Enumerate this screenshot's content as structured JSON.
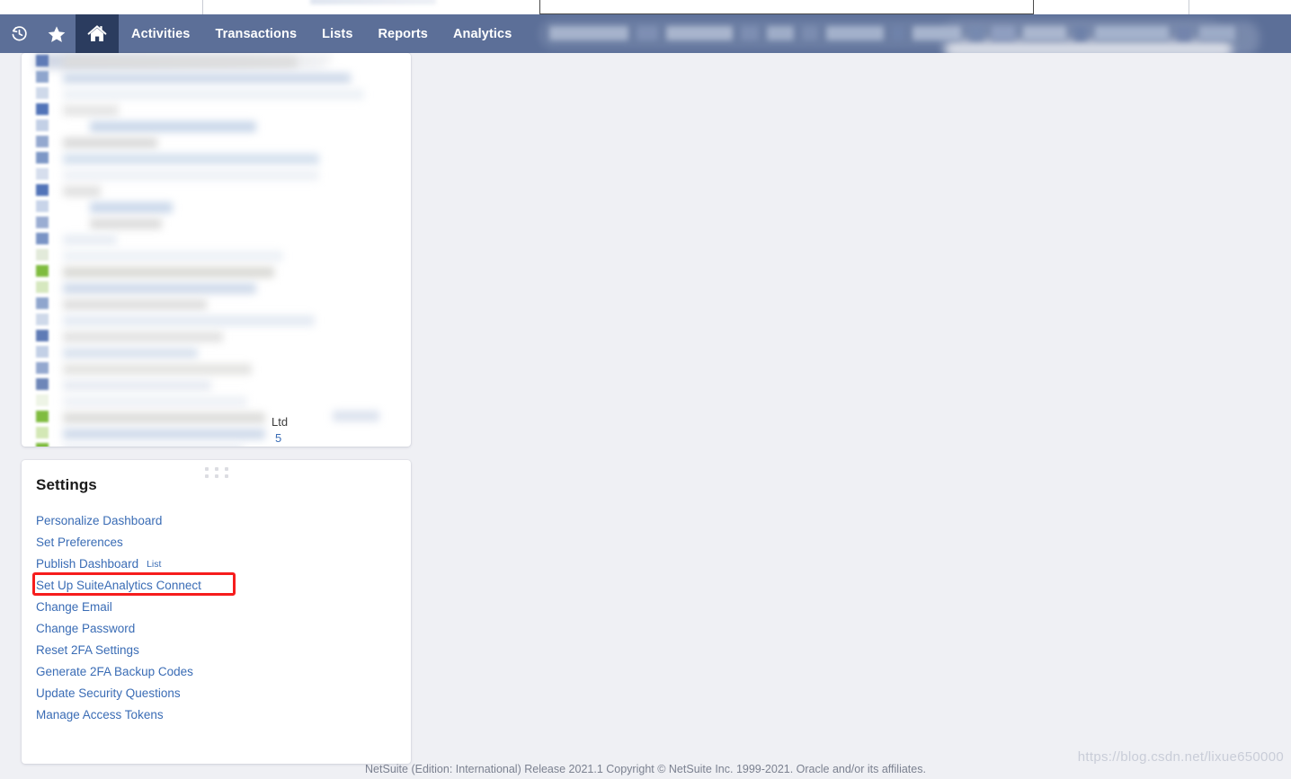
{
  "app": {
    "background_color": "#eff0f4",
    "nav_background_color": "#5c6f98",
    "nav_active_color": "#2b3c5f",
    "link_color": "#3a6cb5",
    "highlight_color": "#f61d1d"
  },
  "navbar": {
    "icons": [
      {
        "name": "recent-history-icon",
        "label": "Recent Records"
      },
      {
        "name": "favorites-star-icon",
        "label": "Shortcuts"
      },
      {
        "name": "home-icon",
        "label": "Home"
      }
    ],
    "menu_items": [
      {
        "label": "Activities"
      },
      {
        "label": "Transactions"
      },
      {
        "label": "Lists"
      },
      {
        "label": "Reports"
      },
      {
        "label": "Analytics"
      }
    ],
    "redacted_note": "blurred menu items"
  },
  "top_panel": {
    "redacted": true,
    "note": "blurred dashboard list portlet",
    "leaked_text": [
      {
        "text": "Ltd"
      },
      {
        "text": "5"
      }
    ]
  },
  "settings_panel": {
    "title": "Settings",
    "links": [
      {
        "label": "Personalize Dashboard",
        "tag": "",
        "highlighted": false
      },
      {
        "label": "Set Preferences",
        "tag": "",
        "highlighted": false
      },
      {
        "label": "Publish Dashboard",
        "tag": "List",
        "highlighted": false
      },
      {
        "label": "Set Up SuiteAnalytics Connect",
        "tag": "",
        "highlighted": true
      },
      {
        "label": "Change Email",
        "tag": "",
        "highlighted": false
      },
      {
        "label": "Change Password",
        "tag": "",
        "highlighted": false
      },
      {
        "label": "Reset 2FA Settings",
        "tag": "",
        "highlighted": false
      },
      {
        "label": "Generate 2FA Backup Codes",
        "tag": "",
        "highlighted": false
      },
      {
        "label": "Update Security Questions",
        "tag": "",
        "highlighted": false
      },
      {
        "label": "Manage Access Tokens",
        "tag": "",
        "highlighted": false
      }
    ]
  },
  "footer": {
    "text": "NetSuite (Edition: International) Release 2021.1 Copyright © NetSuite Inc. 1999-2021. Oracle and/or its affiliates."
  },
  "watermark": {
    "text": "https://blog.csdn.net/lixue650000"
  }
}
